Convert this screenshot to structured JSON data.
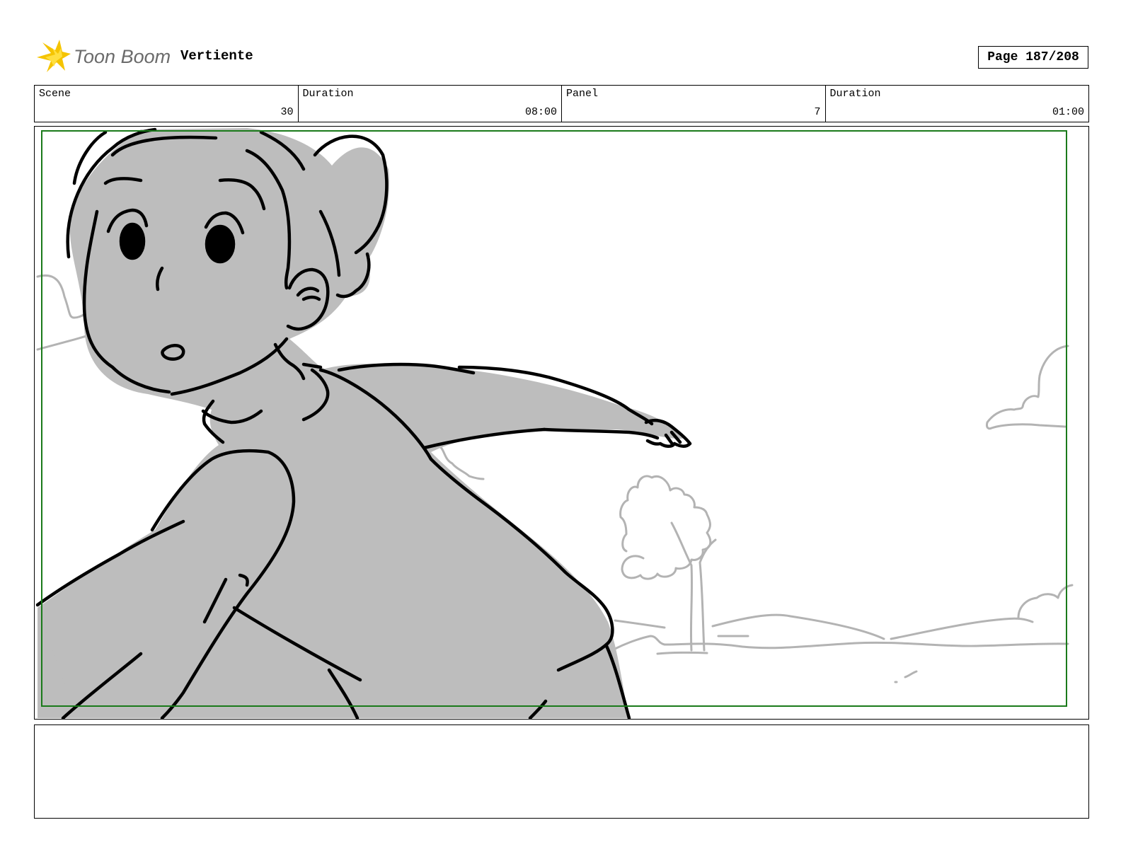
{
  "header": {
    "logo_text": "Toon Boom",
    "project_title": "Vertiente",
    "page_label": "Page 187/208"
  },
  "info": {
    "scene": {
      "label": "Scene",
      "value": "30"
    },
    "scene_duration": {
      "label": "Duration",
      "value": "08:00"
    },
    "panel": {
      "label": "Panel",
      "value": "7"
    },
    "panel_duration": {
      "label": "Duration",
      "value": "01:00"
    }
  },
  "notes": {
    "text": ""
  },
  "colors": {
    "safe_frame": "#1a7a1a",
    "character_fill": "#bdbdbd",
    "background_lines": "#b3b3b3",
    "logo_star": "#f5c400",
    "logo_text": "#6b6b6b"
  }
}
